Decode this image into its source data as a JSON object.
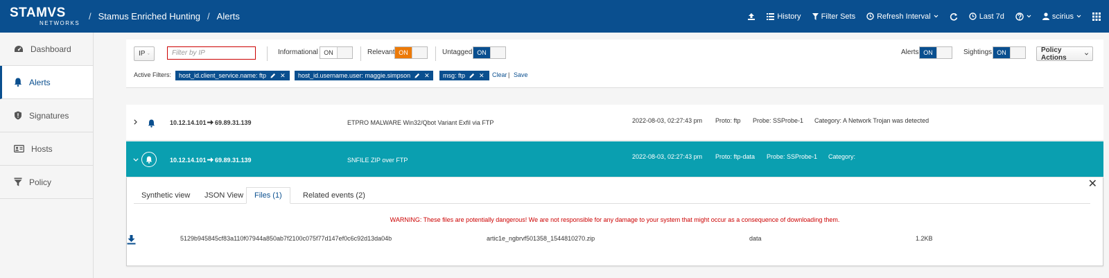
{
  "brand": {
    "name": "STAMVS",
    "sub": "NETWORKS"
  },
  "breadcrumb": {
    "app": "Stamus Enriched Hunting",
    "page": "Alerts"
  },
  "topnav": {
    "history": "History",
    "filter_sets": "Filter Sets",
    "refresh_interval": "Refresh Interval",
    "time_range": "Last 7d",
    "user": "scirius"
  },
  "sidebar": {
    "items": [
      {
        "label": "Dashboard",
        "icon": "dashboard-icon"
      },
      {
        "label": "Alerts",
        "icon": "bell-icon",
        "active": true
      },
      {
        "label": "Signatures",
        "icon": "shield-icon"
      },
      {
        "label": "Hosts",
        "icon": "id-card-icon"
      },
      {
        "label": "Policy",
        "icon": "filter-icon"
      }
    ]
  },
  "filters": {
    "field_select": "IP",
    "input_placeholder": "Filter by IP",
    "informational": {
      "label": "Informational",
      "state": "ON"
    },
    "relevant": {
      "label": "Relevant",
      "state": "ON"
    },
    "untagged": {
      "label": "Untagged",
      "state": "ON"
    },
    "alerts": {
      "label": "Alerts",
      "state": "ON"
    },
    "sightings": {
      "label": "Sightings",
      "state": "ON"
    },
    "policy_actions": "Policy Actions",
    "active_label": "Active Filters:",
    "active": [
      "host_id.client_service.name: ftp",
      "host_id.username.user: maggie.simpson",
      "msg: ftp"
    ],
    "clear": "Clear",
    "save": "Save"
  },
  "alerts": [
    {
      "src": "10.12.14.101",
      "dst": "69.89.31.139",
      "msg": "ETPRO MALWARE Win32/Qbot Variant Exfil via FTP",
      "time": "2022-08-03, 02:27:43 pm",
      "proto": "Proto: ftp",
      "probe": "Probe: SSProbe-1",
      "category": "Category: A Network Trojan was detected"
    },
    {
      "src": "10.12.14.101",
      "dst": "69.89.31.139",
      "msg": "SNFILE ZIP over FTP",
      "time": "2022-08-03, 02:27:43 pm",
      "proto": "Proto: ftp-data",
      "probe": "Probe: SSProbe-1",
      "category": "Category:"
    }
  ],
  "detail": {
    "tabs": [
      "Synthetic view",
      "JSON View",
      "Files (1)",
      "Related events (2)"
    ],
    "active_tab": "Files (1)",
    "warning": "WARNING: These files are potentially dangerous! We are not responsible for any damage to your system that might occur as a consequence of downloading them.",
    "file": {
      "hash": "5129b945845cf83a110f07944a850ab7f2100c075f77d147ef0c6c92d13da04b",
      "name": "artic1e_ngbrvf501358_1544810270.zip",
      "type": "data",
      "size": "1.2KB"
    }
  },
  "colors": {
    "brand": "#0a4f8f",
    "selected_row": "#0a9fb0",
    "relevant_on": "#ec7a08",
    "warning": "#cc0000"
  }
}
